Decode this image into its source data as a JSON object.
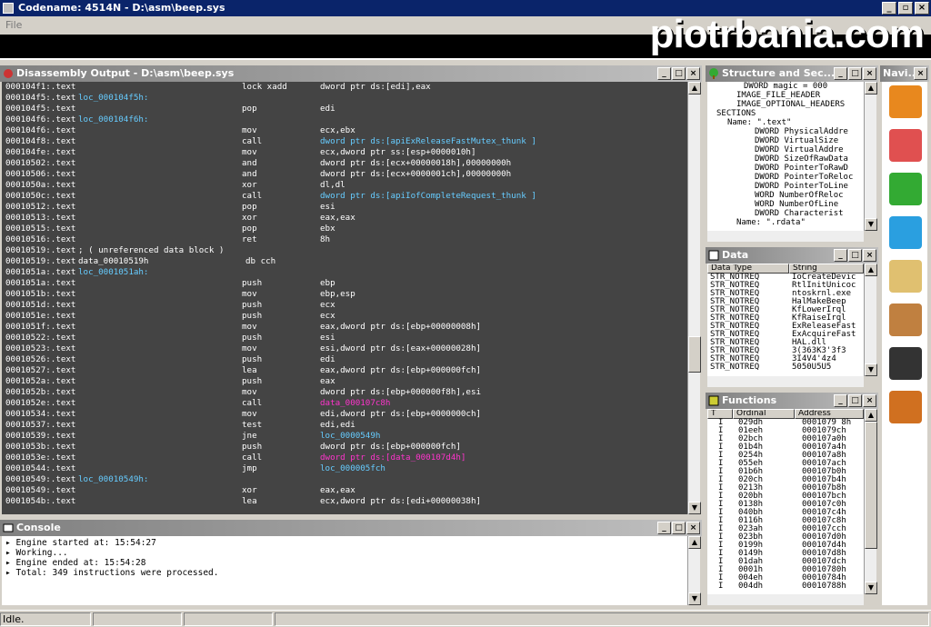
{
  "window": {
    "title": "Codename: 4514N - D:\\asm\\beep.sys",
    "brand": "piotrbania.com"
  },
  "menu": {
    "file": "File"
  },
  "disasm": {
    "title": "Disassembly Output - D:\\asm\\beep.sys",
    "rows": [
      [
        "000104f1:.text",
        "",
        "lock xadd",
        "dword ptr ds:[edi],eax",
        ""
      ],
      [
        "000104f5:.text",
        "loc_000104f5h:",
        "",
        "",
        ""
      ],
      [
        "000104f5:.text",
        "",
        "pop",
        "edi",
        ""
      ],
      [
        "000104f6:.text",
        "loc_000104f6h:",
        "",
        "",
        ""
      ],
      [
        "000104f6:.text",
        "",
        "mov",
        "ecx,ebx",
        ""
      ],
      [
        "000104f8:.text",
        "",
        "call",
        "dword ptr ds:[apiExReleaseFastMutex_thunk ]",
        "l"
      ],
      [
        "000104fe:.text",
        "",
        "mov",
        "ecx,dword ptr ss:[esp+0000010h]",
        ""
      ],
      [
        "00010502:.text",
        "",
        "and",
        "dword ptr ds:[ecx+00000018h],00000000h",
        ""
      ],
      [
        "00010506:.text",
        "",
        "and",
        "dword ptr ds:[ecx+0000001ch],00000000h",
        ""
      ],
      [
        "0001050a:.text",
        "",
        "xor",
        "dl,dl",
        ""
      ],
      [
        "0001050c:.text",
        "",
        "call",
        "dword ptr ds:[apiIofCompleteRequest_thunk ]",
        "l"
      ],
      [
        "00010512:.text",
        "",
        "pop",
        "esi",
        ""
      ],
      [
        "00010513:.text",
        "",
        "xor",
        "eax,eax",
        ""
      ],
      [
        "00010515:.text",
        "",
        "pop",
        "ebx",
        ""
      ],
      [
        "00010516:.text",
        "",
        "ret",
        "8h",
        ""
      ],
      [
        "00010519:.text",
        "; ( unreferenced data block )",
        "",
        "",
        ""
      ],
      [
        "00010519:.text",
        "data_00010519h",
        "db cch",
        "",
        ""
      ],
      [
        "0001051a:.text",
        "loc_0001051ah:",
        "",
        "",
        ""
      ],
      [
        "0001051a:.text",
        "",
        "push",
        "ebp",
        ""
      ],
      [
        "0001051b:.text",
        "",
        "mov",
        "ebp,esp",
        ""
      ],
      [
        "0001051d:.text",
        "",
        "push",
        "ecx",
        ""
      ],
      [
        "0001051e:.text",
        "",
        "push",
        "ecx",
        ""
      ],
      [
        "0001051f:.text",
        "",
        "mov",
        "eax,dword ptr ds:[ebp+00000008h]",
        ""
      ],
      [
        "00010522:.text",
        "",
        "push",
        "esi",
        ""
      ],
      [
        "00010523:.text",
        "",
        "mov",
        "esi,dword ptr ds:[eax+00000028h]",
        ""
      ],
      [
        "00010526:.text",
        "",
        "push",
        "edi",
        ""
      ],
      [
        "00010527:.text",
        "",
        "lea",
        "eax,dword ptr ds:[ebp+000000fch]",
        ""
      ],
      [
        "0001052a:.text",
        "",
        "push",
        "eax",
        ""
      ],
      [
        "0001052b:.text",
        "",
        "mov",
        "dword ptr ds:[ebp+000000f8h],esi",
        ""
      ],
      [
        "0001052e:.text",
        "",
        "call",
        "data_000107c8h",
        "m"
      ],
      [
        "00010534:.text",
        "",
        "mov",
        "edi,dword ptr ds:[ebp+0000000ch]",
        ""
      ],
      [
        "00010537:.text",
        "",
        "test",
        "edi,edi",
        ""
      ],
      [
        "00010539:.text",
        "",
        "jne",
        "loc_0000549h",
        "l"
      ],
      [
        "0001053b:.text",
        "",
        "push",
        "dword ptr ds:[ebp+000000fch]",
        ""
      ],
      [
        "0001053e:.text",
        "",
        "call",
        "dword ptr ds:[data_000107d4h]",
        "m"
      ],
      [
        "00010544:.text",
        "",
        "jmp",
        "loc_000005fch",
        "l"
      ],
      [
        "00010549:.text",
        "loc_00010549h:",
        "",
        "",
        ""
      ],
      [
        "00010549:.text",
        "",
        "xor",
        "eax,eax",
        ""
      ],
      [
        "0001054b:.text",
        "",
        "lea",
        "ecx,dword ptr ds:[edi+00000038h]",
        ""
      ]
    ]
  },
  "console": {
    "title": "Console",
    "lines": [
      "Engine started at: 15:54:27",
      "Working...",
      "Engine ended at: 15:54:28",
      "Total: 349 instructions were processed."
    ]
  },
  "structure": {
    "title": "Structure and Sec...",
    "lines": [
      "DWORD magic       = 000",
      "IMAGE_FILE_HEADER",
      "IMAGE_OPTIONAL_HEADERS",
      "SECTIONS",
      "Name: \".text\"",
      "DWORD PhysicalAddre",
      "DWORD VirtualSize",
      "DWORD VirtualAddre",
      "DWORD SizeOfRawData",
      "DWORD PointerToRawD",
      "DWORD PointerToReloc",
      "DWORD PointerToLine",
      "WORD  NumberOfReloc",
      "WORD  NumberOfLine",
      "DWORD Characterist",
      "Name: \".rdata\""
    ]
  },
  "datap": {
    "title": "Data",
    "col1": "Data Type",
    "col2": "String",
    "rows": [
      [
        "STR_NOTREQ",
        "IoCreateDevic"
      ],
      [
        "STR_NOTREQ",
        "RtlInitUnicoc"
      ],
      [
        "STR_NOTREQ",
        "ntoskrnl.exe"
      ],
      [
        "STR_NOTREQ",
        "HalMakeBeep"
      ],
      [
        "STR_NOTREQ",
        "KfLowerIrql"
      ],
      [
        "STR_NOTREQ",
        "KfRaiseIrql"
      ],
      [
        "STR_NOTREQ",
        "ExReleaseFast"
      ],
      [
        "STR_NOTREQ",
        "ExAcquireFast"
      ],
      [
        "STR_NOTREQ",
        "HAL.dll"
      ],
      [
        "STR_NOTREQ",
        "3(363K3'3f3"
      ],
      [
        "STR_NOTREQ",
        "3I4V4'4z4"
      ],
      [
        "STR_NOTREQ",
        "5050U5U5"
      ]
    ]
  },
  "functions": {
    "title": "Functions",
    "col1": "T",
    "col2": "Ordinal",
    "col3": "Address",
    "rows": [
      [
        "I",
        "029dh",
        "0001079 8h"
      ],
      [
        "I",
        "01eeh",
        "0001079ch"
      ],
      [
        "I",
        "02bch",
        "000107a0h"
      ],
      [
        "I",
        "01b4h",
        "000107a4h"
      ],
      [
        "I",
        "0254h",
        "000107a8h"
      ],
      [
        "I",
        "055eh",
        "000107ach"
      ],
      [
        "I",
        "01b6h",
        "000107b0h"
      ],
      [
        "I",
        "020ch",
        "000107b4h"
      ],
      [
        "I",
        "0213h",
        "000107b8h"
      ],
      [
        "I",
        "020bh",
        "000107bch"
      ],
      [
        "I",
        "0138h",
        "000107c0h"
      ],
      [
        "I",
        "040bh",
        "000107c4h"
      ],
      [
        "I",
        "0116h",
        "000107c8h"
      ],
      [
        "I",
        "023ah",
        "000107cch"
      ],
      [
        "I",
        "023bh",
        "000107d0h"
      ],
      [
        "I",
        "0199h",
        "000107d4h"
      ],
      [
        "I",
        "0149h",
        "000107d8h"
      ],
      [
        "I",
        "01dah",
        "000107dch"
      ],
      [
        "I",
        "0001h",
        "00010780h"
      ],
      [
        "I",
        "004eh",
        "00010784h"
      ],
      [
        "I",
        "004dh",
        "00010788h"
      ]
    ]
  },
  "nav": {
    "title": "Navi..."
  },
  "status": {
    "text": "Idle."
  }
}
